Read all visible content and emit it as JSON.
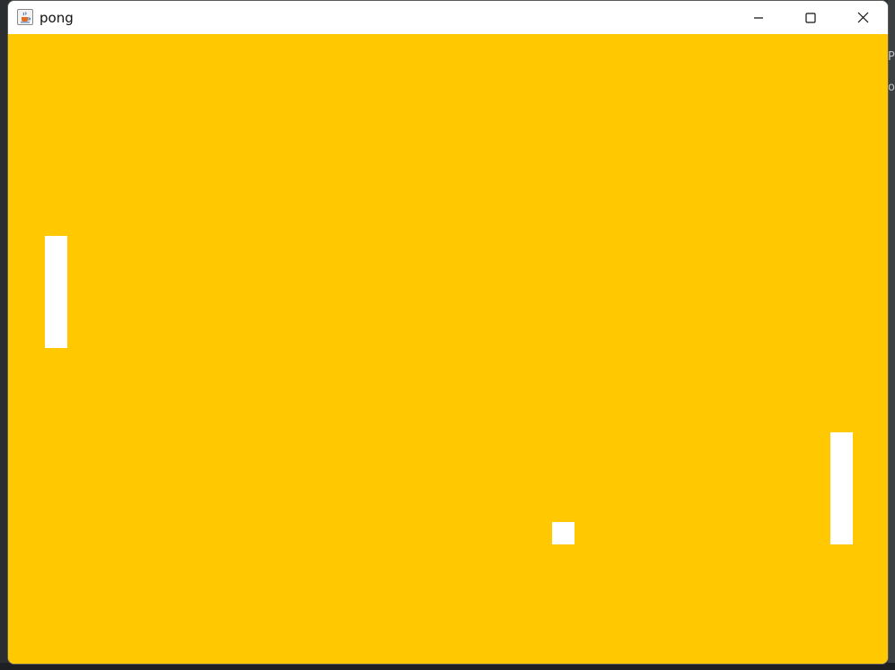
{
  "window": {
    "title": "pong",
    "icon": "java-cup-icon",
    "controls": {
      "minimize": "minimize-icon",
      "maximize": "maximize-icon",
      "close": "close-icon"
    }
  },
  "game": {
    "background_color": "#ffc800",
    "sprite_color": "#ffffff"
  },
  "backdrop": {
    "peek_lines": [
      "P",
      "o"
    ]
  }
}
